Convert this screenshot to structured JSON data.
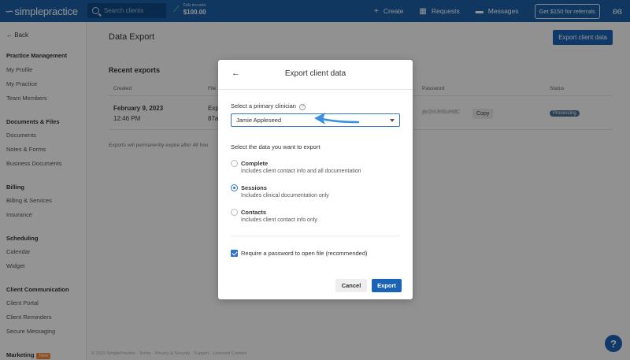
{
  "topnav": {
    "logo": "simplepractice",
    "search_placeholder": "Search clients",
    "income_label": "Feb income",
    "income_value": "$100.00",
    "create": "Create",
    "requests": "Requests",
    "messages": "Messages",
    "referral": "Get $150 for referrals"
  },
  "sidebar": {
    "back": "Back",
    "sections": [
      {
        "title": "Practice Management",
        "items": [
          "My Profile",
          "My Practice",
          "Team Members"
        ]
      },
      {
        "title": "Documents & Files",
        "items": [
          "Documents",
          "Notes & Forms",
          "Business Documents"
        ]
      },
      {
        "title": "Billing",
        "items": [
          "Billing & Services",
          "Insurance"
        ]
      },
      {
        "title": "Scheduling",
        "items": [
          "Calendar",
          "Widget"
        ]
      },
      {
        "title": "Client Communication",
        "items": [
          "Client Portal",
          "Client Reminders",
          "Secure Messaging"
        ]
      },
      {
        "title": "Marketing",
        "badge": "New",
        "items": []
      }
    ]
  },
  "main": {
    "title": "Data Export",
    "export_button": "Export client data",
    "recent_title": "Recent exports",
    "columns": {
      "created": "Created",
      "file": "File",
      "password": "Password",
      "status": "Status"
    },
    "row": {
      "date": "February 9, 2023",
      "time": "12:46 PM",
      "file_line1": "Exp",
      "file_line2": "87a",
      "password": "jbr2nUHSuHdC",
      "copy": "Copy",
      "status": "Processing"
    },
    "note": "Exports will permanently expire after 48 hou",
    "footer": "© 2023 SimplePractice · Terms · Privacy & Security · Support · Licensed Content"
  },
  "modal": {
    "title": "Export client data",
    "clinician_label": "Select a primary clinician",
    "clinician_value": "Jamie Appleseed",
    "data_label": "Select the data you want to export",
    "options": [
      {
        "title": "Complete",
        "desc": "Includes client contact info and all documentation",
        "selected": false
      },
      {
        "title": "Sessions",
        "desc": "Includes clinical documentation only",
        "selected": true
      },
      {
        "title": "Contacts",
        "desc": "Includes client contact info only",
        "selected": false
      }
    ],
    "password_checkbox": "Require a password to open file (recommended)",
    "cancel": "Cancel",
    "export": "Export"
  },
  "colors": {
    "brand": "#1b5fa6",
    "primary_button": "#1b63b5",
    "accent": "#2f76c6",
    "annotation_arrow": "#3a8fe0"
  }
}
